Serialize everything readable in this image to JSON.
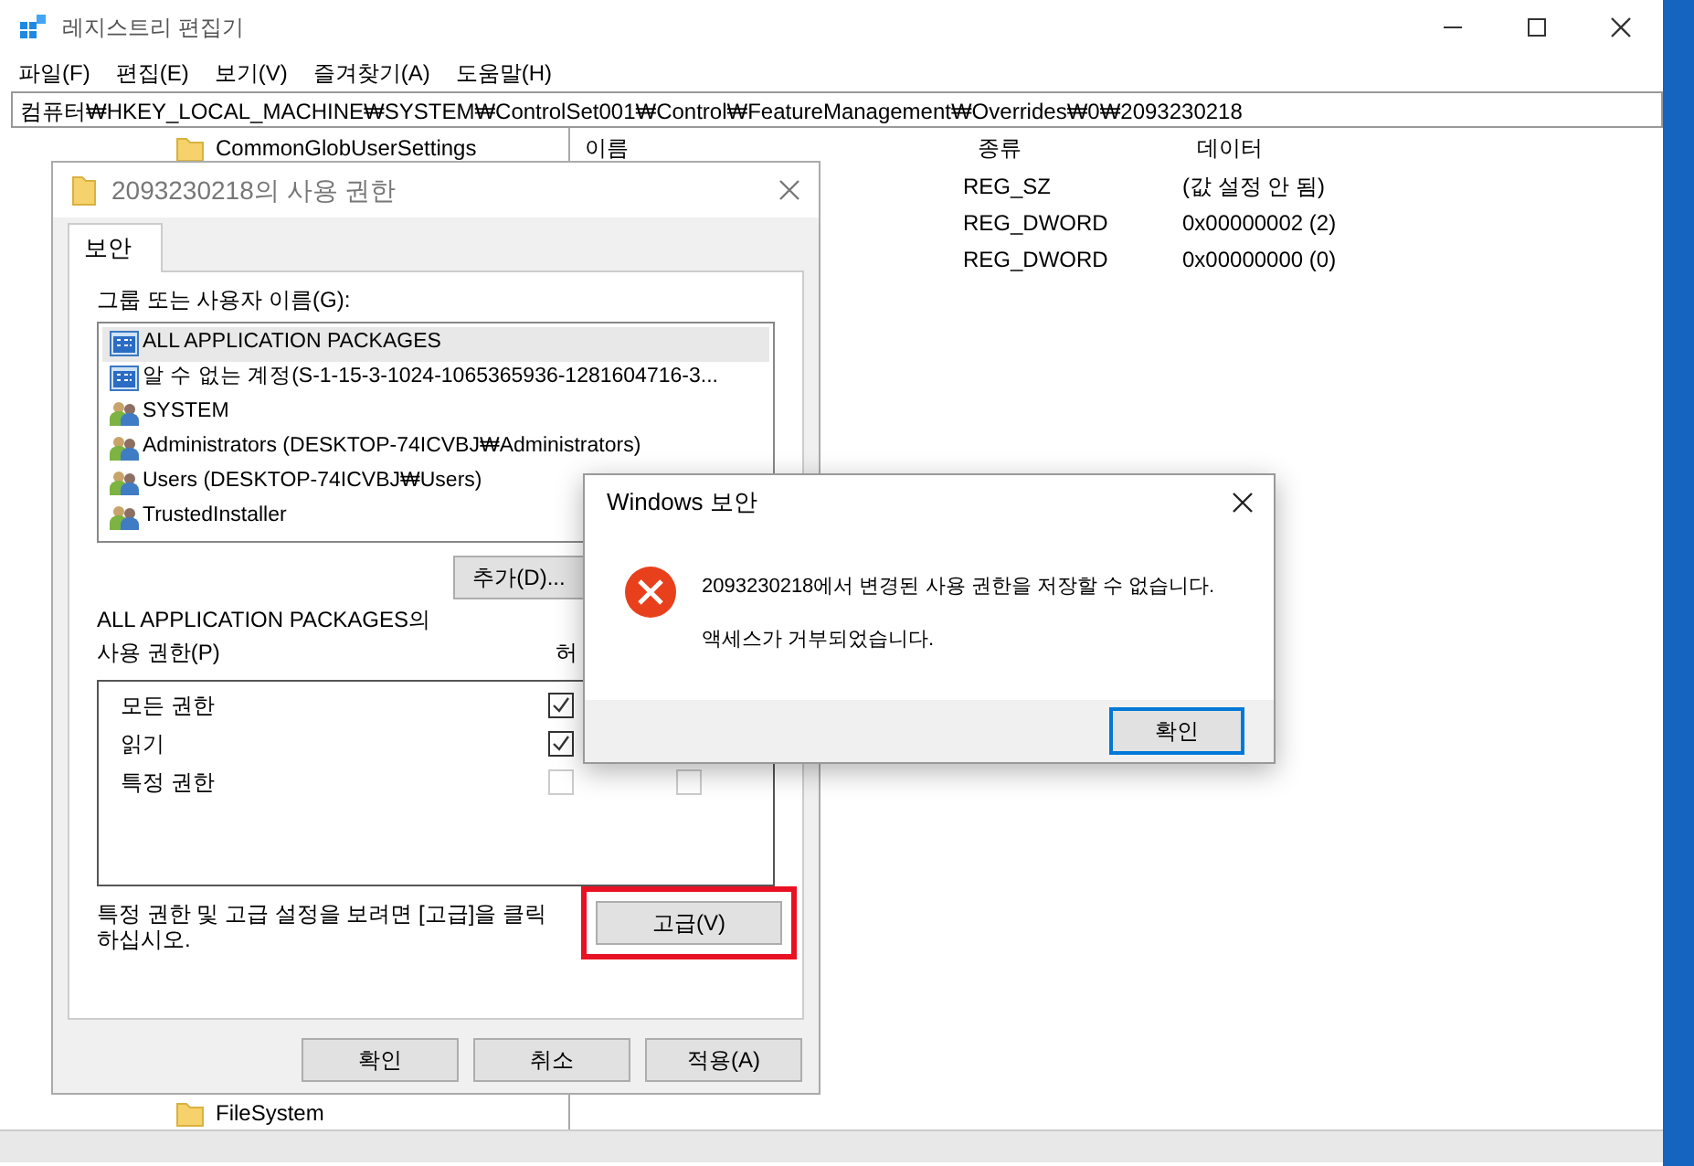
{
  "regedit": {
    "title": "레지스트리 편집기",
    "menu": [
      "파일(F)",
      "편집(E)",
      "보기(V)",
      "즐겨찾기(A)",
      "도움말(H)"
    ],
    "address": "컴퓨터₩HKEY_LOCAL_MACHINE₩SYSTEM₩ControlSet001₩Control₩FeatureManagement₩Overrides₩0₩2093230218",
    "tree_top": "CommonGlobUserSettings",
    "tree_bottom": "FileSystem",
    "columns": [
      "이름",
      "종류",
      "데이터"
    ],
    "rows": [
      {
        "type": "REG_SZ",
        "data": "(값 설정 안 됨)"
      },
      {
        "type": "REG_DWORD",
        "data": "0x00000002 (2)"
      },
      {
        "type": "REG_DWORD",
        "data": "0x00000000 (0)"
      }
    ]
  },
  "permissions_dialog": {
    "title": "2093230218의 사용 권한",
    "tabs": [
      {
        "label": "보안",
        "selected": true
      }
    ],
    "users_label": "그룹 또는 사용자 이름(G):",
    "users": [
      {
        "name": "ALL APPLICATION PACKAGES",
        "kind": "package",
        "selected": true
      },
      {
        "name": "알 수 없는 계정(S-1-15-3-1024-1065365936-1281604716-3...",
        "kind": "package",
        "selected": false
      },
      {
        "name": "SYSTEM",
        "kind": "group",
        "selected": false
      },
      {
        "name": "Administrators (DESKTOP-74ICVBJ₩Administrators)",
        "kind": "group",
        "selected": false
      },
      {
        "name": "Users (DESKTOP-74ICVBJ₩Users)",
        "kind": "group",
        "selected": false
      },
      {
        "name": "TrustedInstaller",
        "kind": "group",
        "selected": false
      }
    ],
    "add_button": "추가(D)...",
    "perm_label": [
      "ALL APPLICATION PACKAGES의",
      "사용 권한(P)"
    ],
    "allow_header": "허",
    "permissions": [
      {
        "name": "모든 권한",
        "allow": {
          "checked": true,
          "disabled": false
        }
      },
      {
        "name": "읽기",
        "allow": {
          "checked": true,
          "disabled": false
        }
      },
      {
        "name": "특정 권한",
        "allow": {
          "checked": false,
          "disabled": true
        },
        "deny": {
          "checked": false,
          "disabled": true
        }
      }
    ],
    "advanced_note": "특정 권한 및 고급 설정을 보려면 [고급]을 클릭 하십시오.",
    "advanced_button": "고급(V)",
    "advanced_highlighted": true,
    "buttons": [
      "확인",
      "취소",
      "적용(A)"
    ]
  },
  "message_box": {
    "title": "Windows 보안",
    "lines": [
      "2093230218에서 변경된 사용 권한을 저장할 수 없습니다.",
      "액세스가 거부되었습니다."
    ],
    "button": "확인"
  }
}
